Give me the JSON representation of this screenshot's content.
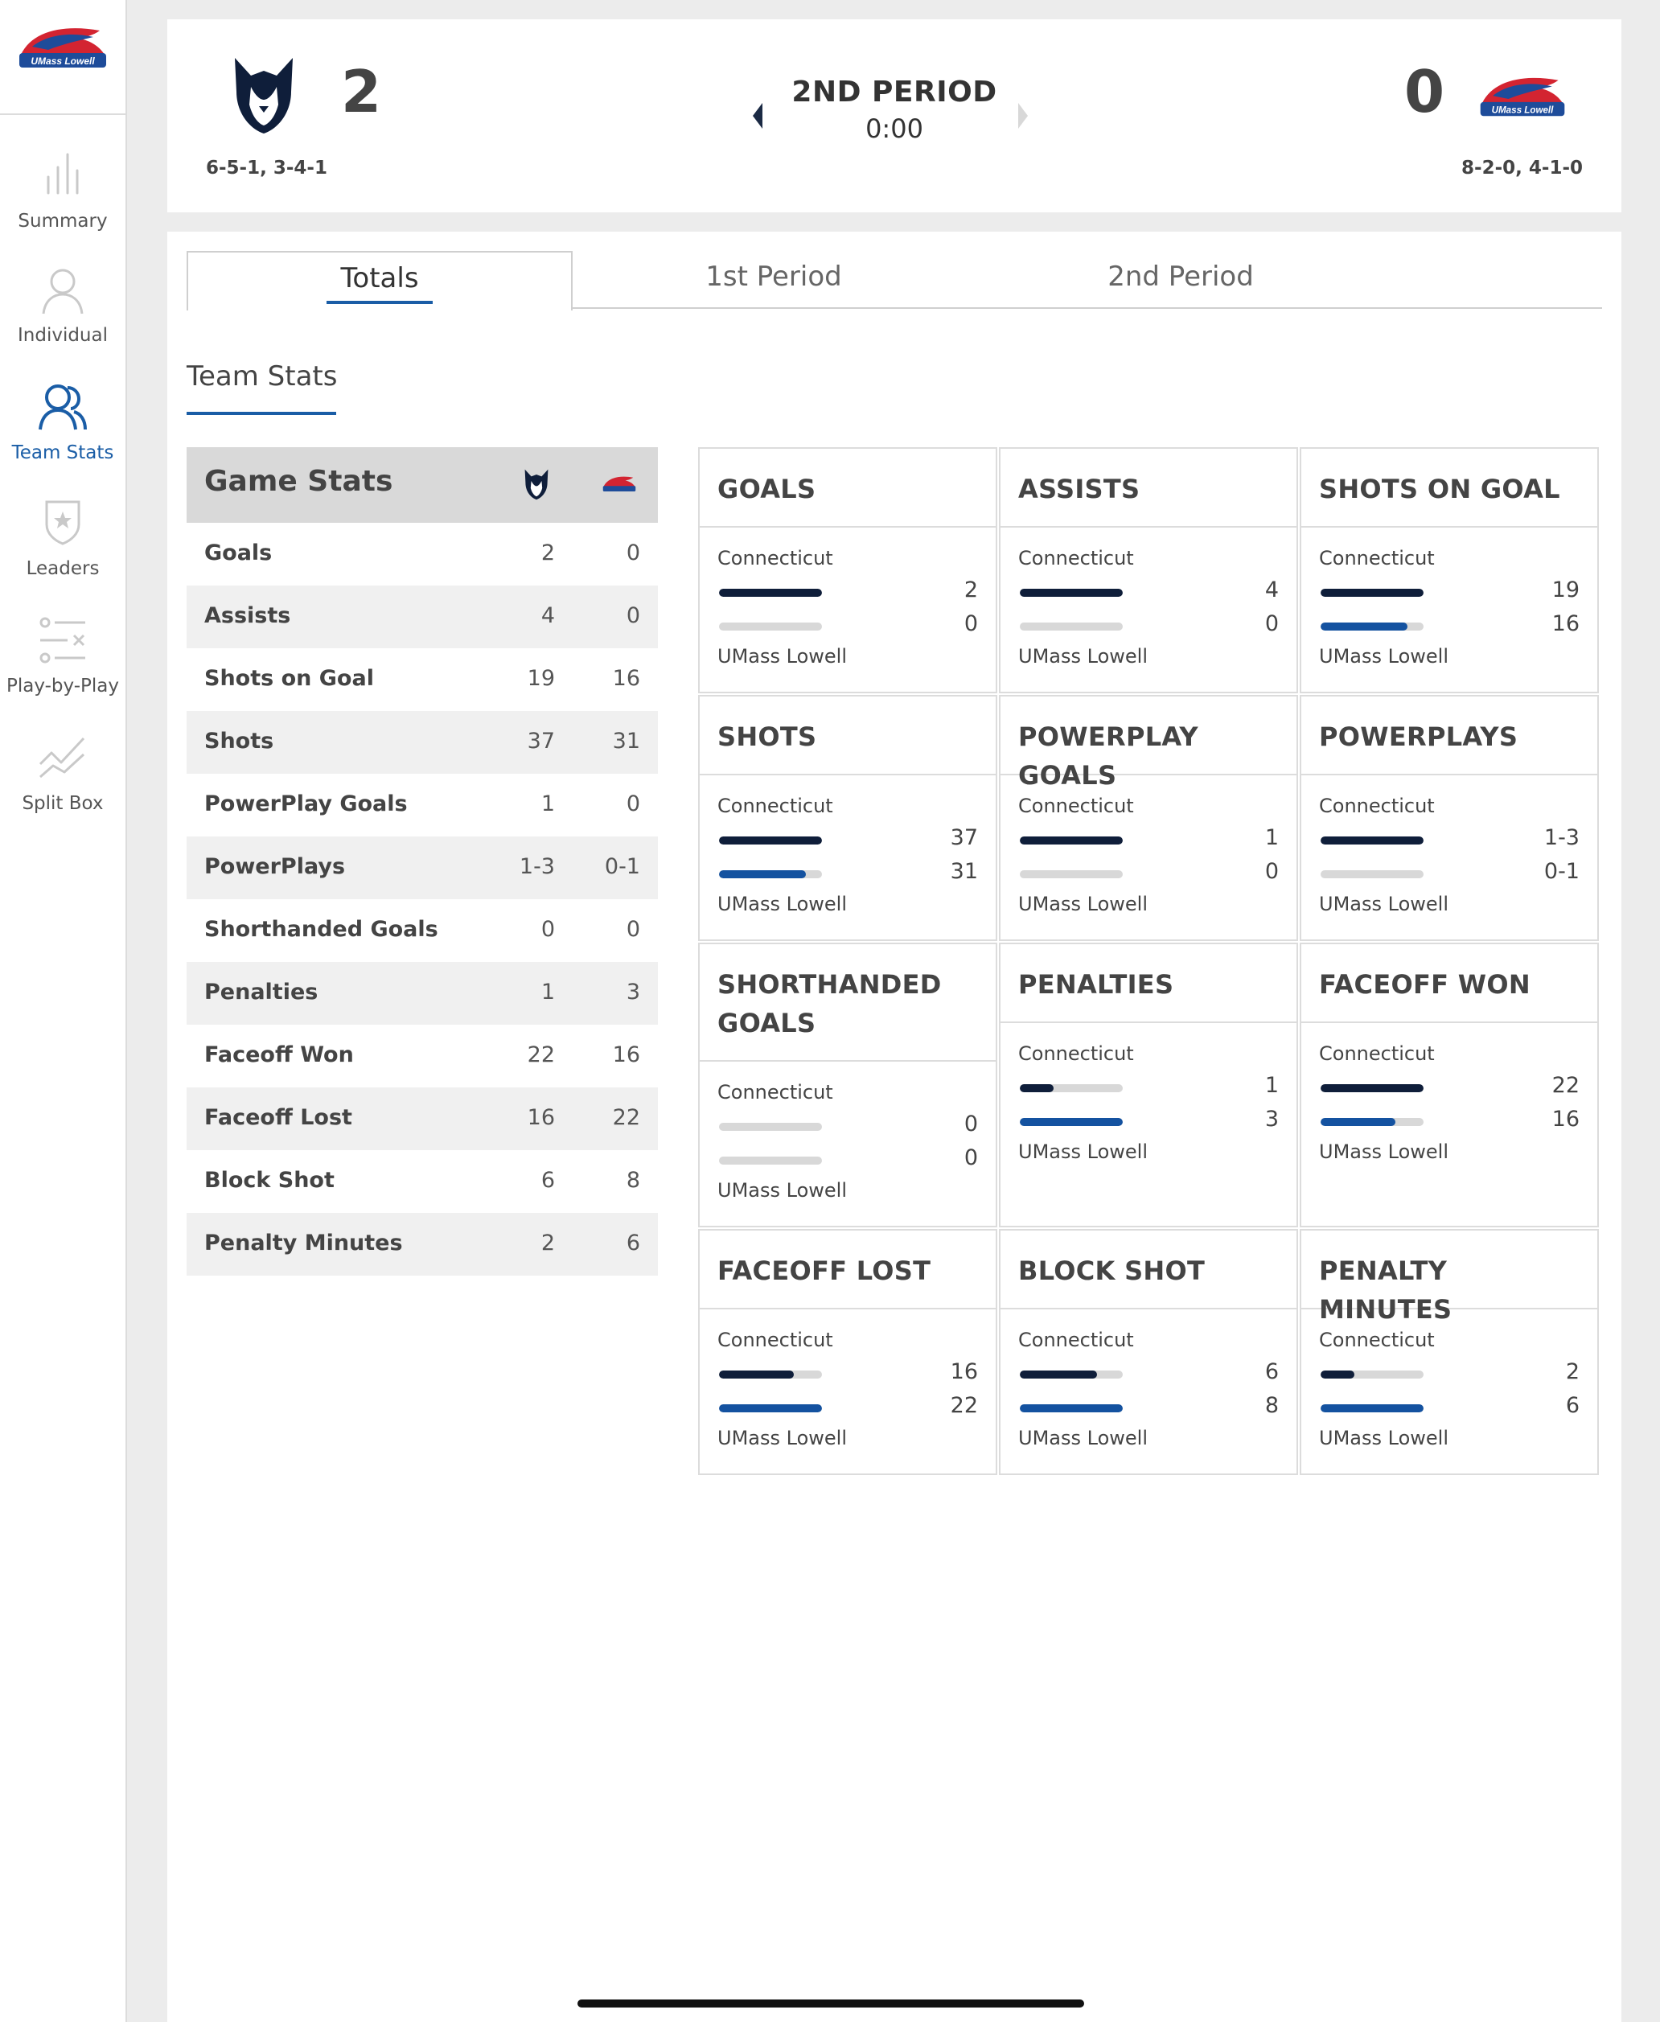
{
  "nav": {
    "items": [
      {
        "label": "Summary",
        "icon": "bar-chart-icon"
      },
      {
        "label": "Individual",
        "icon": "person-icon"
      },
      {
        "label": "Team Stats",
        "icon": "people-icon",
        "active": true
      },
      {
        "label": "Leaders",
        "icon": "badge-star-icon"
      },
      {
        "label": "Play-by-Play",
        "icon": "list-icon"
      },
      {
        "label": "Split Box",
        "icon": "trend-chart-icon"
      }
    ]
  },
  "score": {
    "home": {
      "score": "2",
      "record": "6-5-1, 3-4-1"
    },
    "away": {
      "score": "0",
      "record": "8-2-0, 4-1-0"
    },
    "period": "2ND PERIOD",
    "clock": "0:00"
  },
  "tabs": [
    "Totals",
    "1st Period",
    "2nd Period"
  ],
  "section_title": "Team Stats",
  "game_stats": {
    "title": "Game Stats",
    "rows": [
      {
        "name": "Goals",
        "home": "2",
        "away": "0"
      },
      {
        "name": "Assists",
        "home": "4",
        "away": "0"
      },
      {
        "name": "Shots on Goal",
        "home": "19",
        "away": "16"
      },
      {
        "name": "Shots",
        "home": "37",
        "away": "31"
      },
      {
        "name": "PowerPlay Goals",
        "home": "1",
        "away": "0"
      },
      {
        "name": "PowerPlays",
        "home": "1-3",
        "away": "0-1"
      },
      {
        "name": "Shorthanded Goals",
        "home": "0",
        "away": "0"
      },
      {
        "name": "Penalties",
        "home": "1",
        "away": "3"
      },
      {
        "name": "Faceoff Won",
        "home": "22",
        "away": "16"
      },
      {
        "name": "Faceoff Lost",
        "home": "16",
        "away": "22"
      },
      {
        "name": "Block Shot",
        "home": "6",
        "away": "8"
      },
      {
        "name": "Penalty Minutes",
        "home": "2",
        "away": "6"
      }
    ]
  },
  "cards": [
    {
      "title": "GOALS",
      "home_team": "Connecticut",
      "away_team": "UMass Lowell",
      "home_value": "2",
      "away_value": "0",
      "home_fill": 1.0,
      "away_fill": 0.0
    },
    {
      "title": "ASSISTS",
      "home_team": "Connecticut",
      "away_team": "UMass Lowell",
      "home_value": "4",
      "away_value": "0",
      "home_fill": 1.0,
      "away_fill": 0.0
    },
    {
      "title": "SHOTS ON GOAL",
      "home_team": "Connecticut",
      "away_team": "UMass Lowell",
      "home_value": "19",
      "away_value": "16",
      "home_fill": 1.0,
      "away_fill": 0.84
    },
    {
      "title": "SHOTS",
      "home_team": "Connecticut",
      "away_team": "UMass Lowell",
      "home_value": "37",
      "away_value": "31",
      "home_fill": 1.0,
      "away_fill": 0.84
    },
    {
      "title": "POWERPLAY GOALS",
      "home_team": "Connecticut",
      "away_team": "UMass Lowell",
      "home_value": "1",
      "away_value": "0",
      "home_fill": 1.0,
      "away_fill": 0.0
    },
    {
      "title": "POWERPLAYS",
      "home_team": "Connecticut",
      "away_team": "UMass Lowell",
      "home_value": "1-3",
      "away_value": "0-1",
      "home_fill": 1.0,
      "away_fill": 0.0
    },
    {
      "title": "SHORTHANDED GOALS",
      "home_team": "Connecticut",
      "away_team": "UMass Lowell",
      "home_value": "0",
      "away_value": "0",
      "home_fill": 0.0,
      "away_fill": 0.0
    },
    {
      "title": "PENALTIES",
      "home_team": "Connecticut",
      "away_team": "UMass Lowell",
      "home_value": "1",
      "away_value": "3",
      "home_fill": 0.33,
      "away_fill": 1.0
    },
    {
      "title": "FACEOFF WON",
      "home_team": "Connecticut",
      "away_team": "UMass Lowell",
      "home_value": "22",
      "away_value": "16",
      "home_fill": 1.0,
      "away_fill": 0.73
    },
    {
      "title": "FACEOFF LOST",
      "home_team": "Connecticut",
      "away_team": "UMass Lowell",
      "home_value": "16",
      "away_value": "22",
      "home_fill": 0.73,
      "away_fill": 1.0
    },
    {
      "title": "BLOCK SHOT",
      "home_team": "Connecticut",
      "away_team": "UMass Lowell",
      "home_value": "6",
      "away_value": "8",
      "home_fill": 0.75,
      "away_fill": 1.0
    },
    {
      "title": "PENALTY MINUTES",
      "home_team": "Connecticut",
      "away_team": "UMass Lowell",
      "home_value": "2",
      "away_value": "6",
      "home_fill": 0.33,
      "away_fill": 1.0
    }
  ],
  "colors": {
    "accent": "#1a5da6",
    "home_bar": "#0f1e3a",
    "away_bar": "#1452a0",
    "track": "#d8d8d8"
  }
}
